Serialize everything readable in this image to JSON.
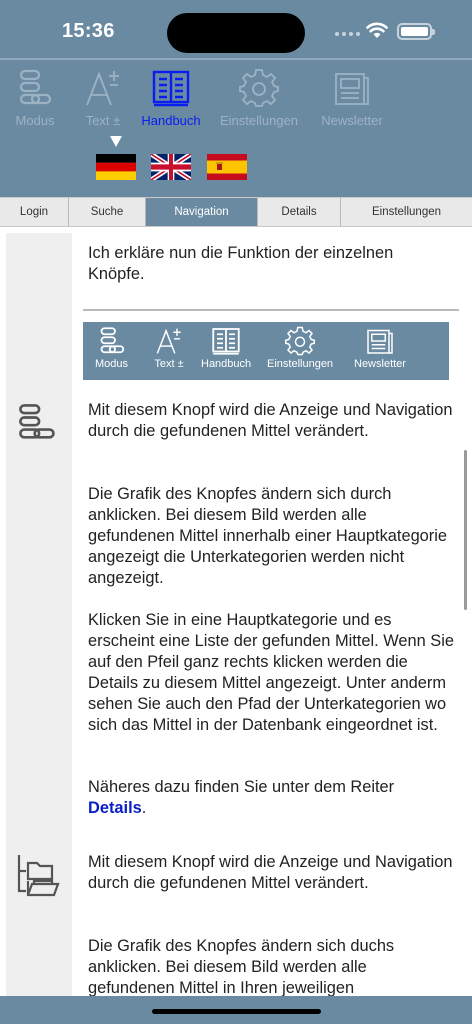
{
  "status": {
    "time": "15:36"
  },
  "toolbar": {
    "items": [
      {
        "label": "Modus",
        "icon": "modus-icon"
      },
      {
        "label": "Text ±",
        "icon": "text-size-icon"
      },
      {
        "label": "Handbuch",
        "icon": "book-icon"
      },
      {
        "label": "Einstellungen",
        "icon": "gear-icon"
      },
      {
        "label": "Newsletter",
        "icon": "newsletter-icon"
      }
    ],
    "active_index": 2,
    "active_color": "#0a1ef0",
    "inactive_color": "#9cb3c4"
  },
  "languages": [
    {
      "name": "flag-germany",
      "selected": true
    },
    {
      "name": "flag-uk",
      "selected": false
    },
    {
      "name": "flag-spain",
      "selected": false
    }
  ],
  "tabs": [
    {
      "label": "Login"
    },
    {
      "label": "Suche"
    },
    {
      "label": "Navigation"
    },
    {
      "label": "Details"
    },
    {
      "label": "Einstellungen"
    }
  ],
  "active_tab": "Navigation",
  "content": {
    "intro": "Ich erkläre nun die Funktion der einzelnen Knöpfe.",
    "guide_bar": {
      "items": [
        {
          "label": "Modus"
        },
        {
          "label": "Text ±"
        },
        {
          "label": "Handbuch"
        },
        {
          "label": "Einstellungen"
        },
        {
          "label": "Newsletter"
        }
      ]
    },
    "section1": {
      "p1": "Mit diesem Knopf wird die Anzeige und Navigation durch die gefundenen Mittel verändert.",
      "p2": "Die Grafik des Knopfes ändern sich durch anklicken. Bei diesem Bild werden alle gefundenen Mittel innerhalb einer Hauptkategorie angezeigt die Unterkategorien werden nicht angezeigt.",
      "p3": "Klicken Sie in eine Hauptkategorie und es erscheint eine Liste der gefunden Mittel. Wenn Sie auf den Pfeil ganz rechts klicken werden die Details zu diesem Mittel angezeigt. Unter anderm sehen Sie auch den Pfad der Unterkategorien wo sich das Mittel in der Datenbank eingeordnet ist.",
      "p4_prefix": "Näheres dazu finden Sie unter dem Reiter",
      "p4_link": "Details",
      "p4_suffix": "."
    },
    "section2": {
      "p1": "Mit diesem Knopf wird die Anzeige und Navigation durch die gefundenen Mittel verändert.",
      "p2": "Die Grafik des Knopfes ändern sich duchs anklicken. Bei diesem Bild werden alle gefundenen Mittel in Ihren jeweiligen"
    }
  },
  "colors": {
    "bar": "#6a8aa2",
    "link": "#0a1ec8"
  }
}
